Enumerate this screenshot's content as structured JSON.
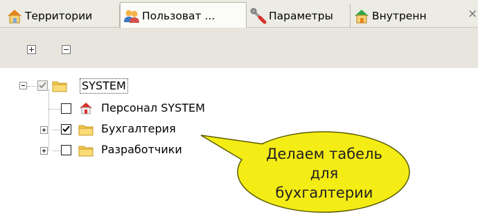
{
  "tabs": [
    {
      "label": "Территории",
      "icon": "house-icon",
      "active": false
    },
    {
      "label": "Пользоват ...",
      "icon": "users-icon",
      "active": true
    },
    {
      "label": "Параметры",
      "icon": "wrench-icon",
      "active": false
    },
    {
      "label": "Внутренн",
      "icon": "house-icon",
      "active": false
    }
  ],
  "tab_close_glyph": "×",
  "toolbar": {
    "expand_icon": "plus-box-icon",
    "collapse_icon": "minus-box-icon"
  },
  "tree": {
    "root": {
      "label": "SYSTEM",
      "checked": true,
      "expanded": true,
      "icon": "folder-icon"
    },
    "children": [
      {
        "label": "Персонал SYSTEM",
        "checked": false,
        "expandable": false,
        "icon": "house-icon"
      },
      {
        "label": "Бухгалтерия",
        "checked": true,
        "expandable": true,
        "icon": "folder-icon"
      },
      {
        "label": "Разработчики",
        "checked": false,
        "expandable": true,
        "icon": "folder-icon"
      }
    ]
  },
  "callout": {
    "lines": [
      "Делаем табель",
      "для",
      "бухгалтерии"
    ],
    "fill": "#f4ec15"
  }
}
